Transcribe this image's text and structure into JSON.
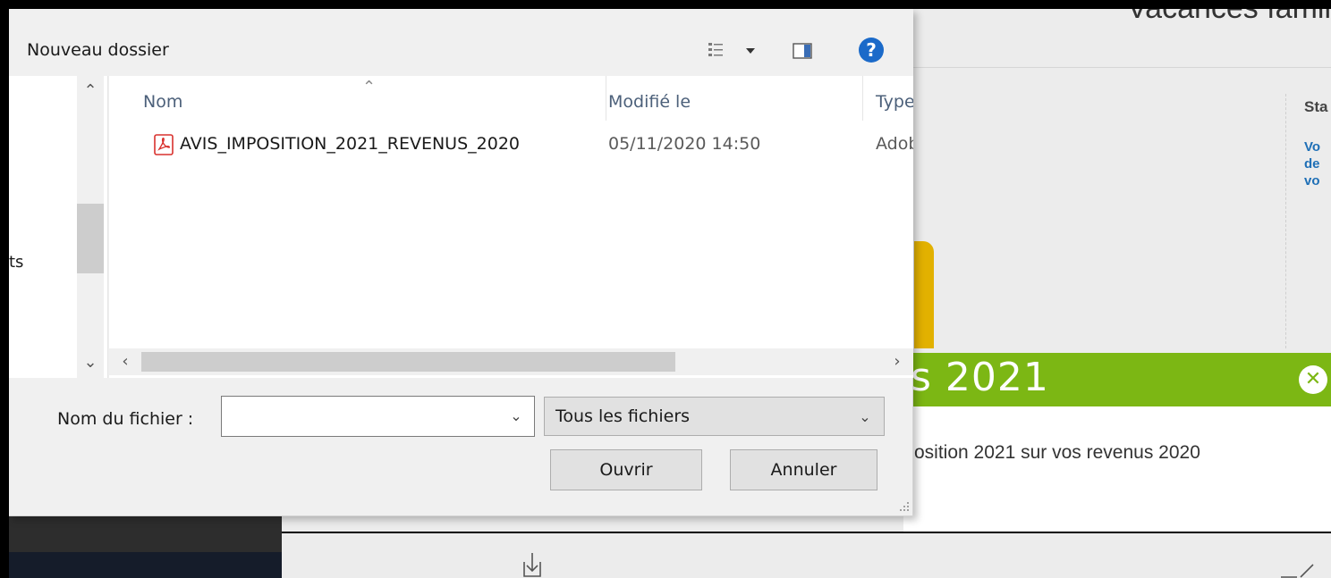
{
  "background_page": {
    "top_title": "Vacances famil",
    "right_panel": {
      "heading": "Sta",
      "lines": [
        "Vo",
        "de",
        "vo"
      ]
    },
    "banner_text": "s 2021",
    "description": "osition 2021 sur vos revenus 2020"
  },
  "dialog": {
    "toolbar": {
      "new_folder": "Nouveau dossier"
    },
    "nav_pane": {
      "visible_label": "ts"
    },
    "columns": {
      "name": "Nom",
      "modified": "Modifié le",
      "type": "Type"
    },
    "files": [
      {
        "name": "AVIS_IMPOSITION_2021_REVENUS_2020",
        "modified": "05/11/2020 14:50",
        "type": "Adob",
        "icon": "pdf-icon"
      }
    ],
    "filename": {
      "label": "Nom du fichier :",
      "value": ""
    },
    "filetype": {
      "selected": "Tous les fichiers"
    },
    "buttons": {
      "open": "Ouvrir",
      "cancel": "Annuler"
    },
    "colors": {
      "help_blue": "#1b6ac9",
      "pdf_red": "#d9322e",
      "banner_green": "#7cb714"
    }
  }
}
